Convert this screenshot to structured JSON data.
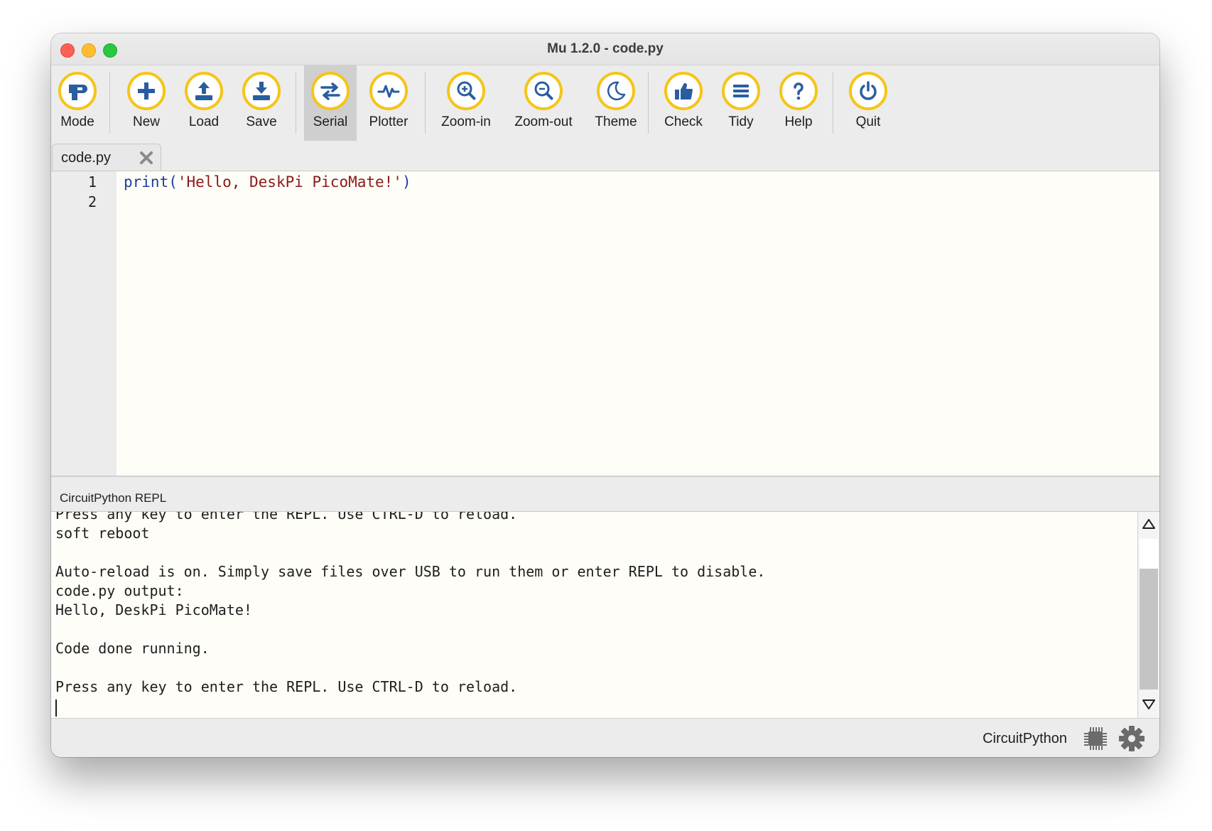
{
  "window": {
    "title": "Mu 1.2.0 - code.py"
  },
  "toolbar": {
    "buttons": [
      {
        "id": "mode",
        "label": "Mode",
        "icon": "mode-icon"
      },
      {
        "id": "new",
        "label": "New",
        "icon": "plus-icon"
      },
      {
        "id": "load",
        "label": "Load",
        "icon": "upload-icon"
      },
      {
        "id": "save",
        "label": "Save",
        "icon": "download-icon"
      },
      {
        "id": "serial",
        "label": "Serial",
        "icon": "swap-arrows-icon",
        "active": true
      },
      {
        "id": "plotter",
        "label": "Plotter",
        "icon": "pulse-icon"
      },
      {
        "id": "zoom-in",
        "label": "Zoom-in",
        "icon": "zoom-in-icon"
      },
      {
        "id": "zoom-out",
        "label": "Zoom-out",
        "icon": "zoom-out-icon"
      },
      {
        "id": "theme",
        "label": "Theme",
        "icon": "moon-icon"
      },
      {
        "id": "check",
        "label": "Check",
        "icon": "thumbs-up-icon"
      },
      {
        "id": "tidy",
        "label": "Tidy",
        "icon": "lines-icon"
      },
      {
        "id": "help",
        "label": "Help",
        "icon": "question-icon"
      },
      {
        "id": "quit",
        "label": "Quit",
        "icon": "power-icon"
      }
    ]
  },
  "tabs": [
    {
      "label": "code.py",
      "active": true
    }
  ],
  "editor": {
    "lines": [
      {
        "number": "1",
        "func": "print",
        "open": "(",
        "string": "'Hello, DeskPi PicoMate!'",
        "close": ")"
      },
      {
        "number": "2"
      }
    ]
  },
  "repl": {
    "title": "CircuitPython REPL",
    "lines": [
      "Press any key to enter the REPL. Use CTRL-D to reload.",
      "soft reboot",
      "",
      "Auto-reload is on. Simply save files over USB to run them or enter REPL to disable.",
      "code.py output:",
      "Hello, DeskPi PicoMate!",
      "",
      "Code done running.",
      "",
      "Press any key to enter the REPL. Use CTRL-D to reload."
    ]
  },
  "status": {
    "mode": "CircuitPython",
    "chip_icon": "chip-icon",
    "settings_icon": "gear-icon"
  },
  "colors": {
    "accent_ring": "#f5c518",
    "icon": "#2a5d9f",
    "editor_bg": "#fefdf7"
  }
}
